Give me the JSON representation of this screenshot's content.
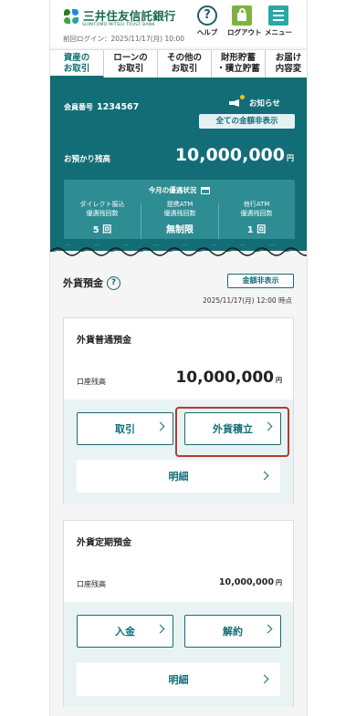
{
  "header": {
    "logo_text": "三井住友信託銀行",
    "logo_sub": "SUMITOMO MITSUI TRUST BANK",
    "last_login": "前回ログイン：2025/11/17(月) 10:00",
    "help_label": "ヘルプ",
    "logout_label": "ログアウト",
    "menu_label": "メニュー",
    "help_glyph": "?"
  },
  "tabs": [
    {
      "label": "資産の\nお取引",
      "active": true
    },
    {
      "label": "ローンの\nお取引",
      "active": false
    },
    {
      "label": "その他の\nお取引",
      "active": false
    },
    {
      "label": "財形貯蓄\n・積立貯蓄",
      "active": false
    },
    {
      "label": "お届け\n内容変",
      "active": false
    }
  ],
  "account": {
    "member_label": "会員番号",
    "member_number": "1234567",
    "notice_label": "お知らせ",
    "hide_all_label": "全ての金額非表示",
    "balance_label": "お預かり残高",
    "balance_value": "10,000,000",
    "yen": "円",
    "benefit_title": "今月の優遇状況",
    "benefits": [
      {
        "title": "ダイレクト振込\n優遇残回数",
        "value": "5 回"
      },
      {
        "title": "提携ATM\n優遇残回数",
        "value": "無制限"
      },
      {
        "title": "他行ATM\n優遇残回数",
        "value": "1 回"
      }
    ]
  },
  "foreign": {
    "title": "外貨預金",
    "help_glyph": "?",
    "hide_label": "金額非表示",
    "as_of": "2025/11/17(月) 12:00 時点",
    "ordinary": {
      "title": "外貨普通預金",
      "balance_label": "口座残高",
      "balance": "10,000,000",
      "yen": "円",
      "btn_left": "取引",
      "btn_right": "外貨積立",
      "detail": "明細"
    },
    "time": {
      "title": "外貨定期預金",
      "balance_label": "口座残高",
      "balance": "10,000,000",
      "yen": "円",
      "btn_left": "入金",
      "btn_right": "解約",
      "detail": "明細"
    }
  },
  "colors": {
    "brand_teal": "#136d76",
    "benefit_panel": "#2e8c93",
    "logo_green": "#176b4f",
    "highlight_red": "#b83a2c",
    "logout_green": "#7cb342",
    "menu_teal": "#2aa6a6"
  }
}
